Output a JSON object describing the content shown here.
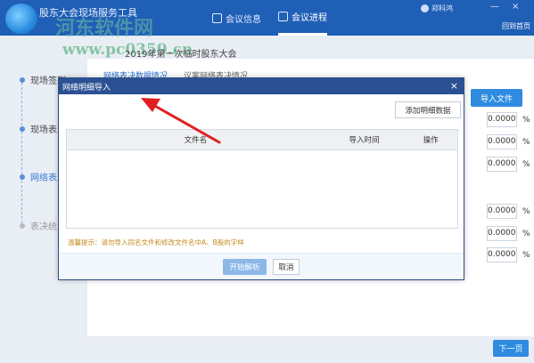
{
  "header": {
    "app_title": "股东大会现场服务工具",
    "tabs": [
      {
        "label": "会议信息",
        "icon": "file-icon"
      },
      {
        "label": "会议进程",
        "icon": "process-icon",
        "active": true
      }
    ],
    "user_name": "郑科鸿",
    "back_home": "回到首页",
    "window_controls": [
      "—",
      "×"
    ]
  },
  "watermark": {
    "line1": "河东软件网",
    "line2": "www.pc0359.cn"
  },
  "meeting_title": "2019年第一次临时股东大会",
  "steps": [
    {
      "label": "现场签到"
    },
    {
      "label": "现场表决"
    },
    {
      "label": "网络表决"
    },
    {
      "label": "表决统计"
    }
  ],
  "main": {
    "sub_tabs": [
      {
        "label": "网络表决数据情况",
        "active": true
      },
      {
        "label": "议案网络表决情况"
      }
    ],
    "import_button": "导入文件",
    "percent_values": [
      "0.0000",
      "0.0000",
      "0.0000",
      "0.0000",
      "0.0000",
      "0.0000"
    ],
    "percent_sign": "%",
    "next_button": "下一页"
  },
  "modal": {
    "title": "网络明细导入",
    "close": "×",
    "add_detail_button": "添加明细数据",
    "columns": [
      "文件名",
      "导入时间",
      "操作"
    ],
    "tip": "温馨提示：请勿导入同名文件和修改文件名中A、B股的字样",
    "start_button": "开始解析",
    "cancel_button": "取消"
  },
  "colors": {
    "header_bg": "#1f5fb6",
    "modal_header": "#2b5193",
    "primary_button": "#2e8be0",
    "tip_text": "#c58a1f",
    "annotation_arrow": "#e02020"
  }
}
